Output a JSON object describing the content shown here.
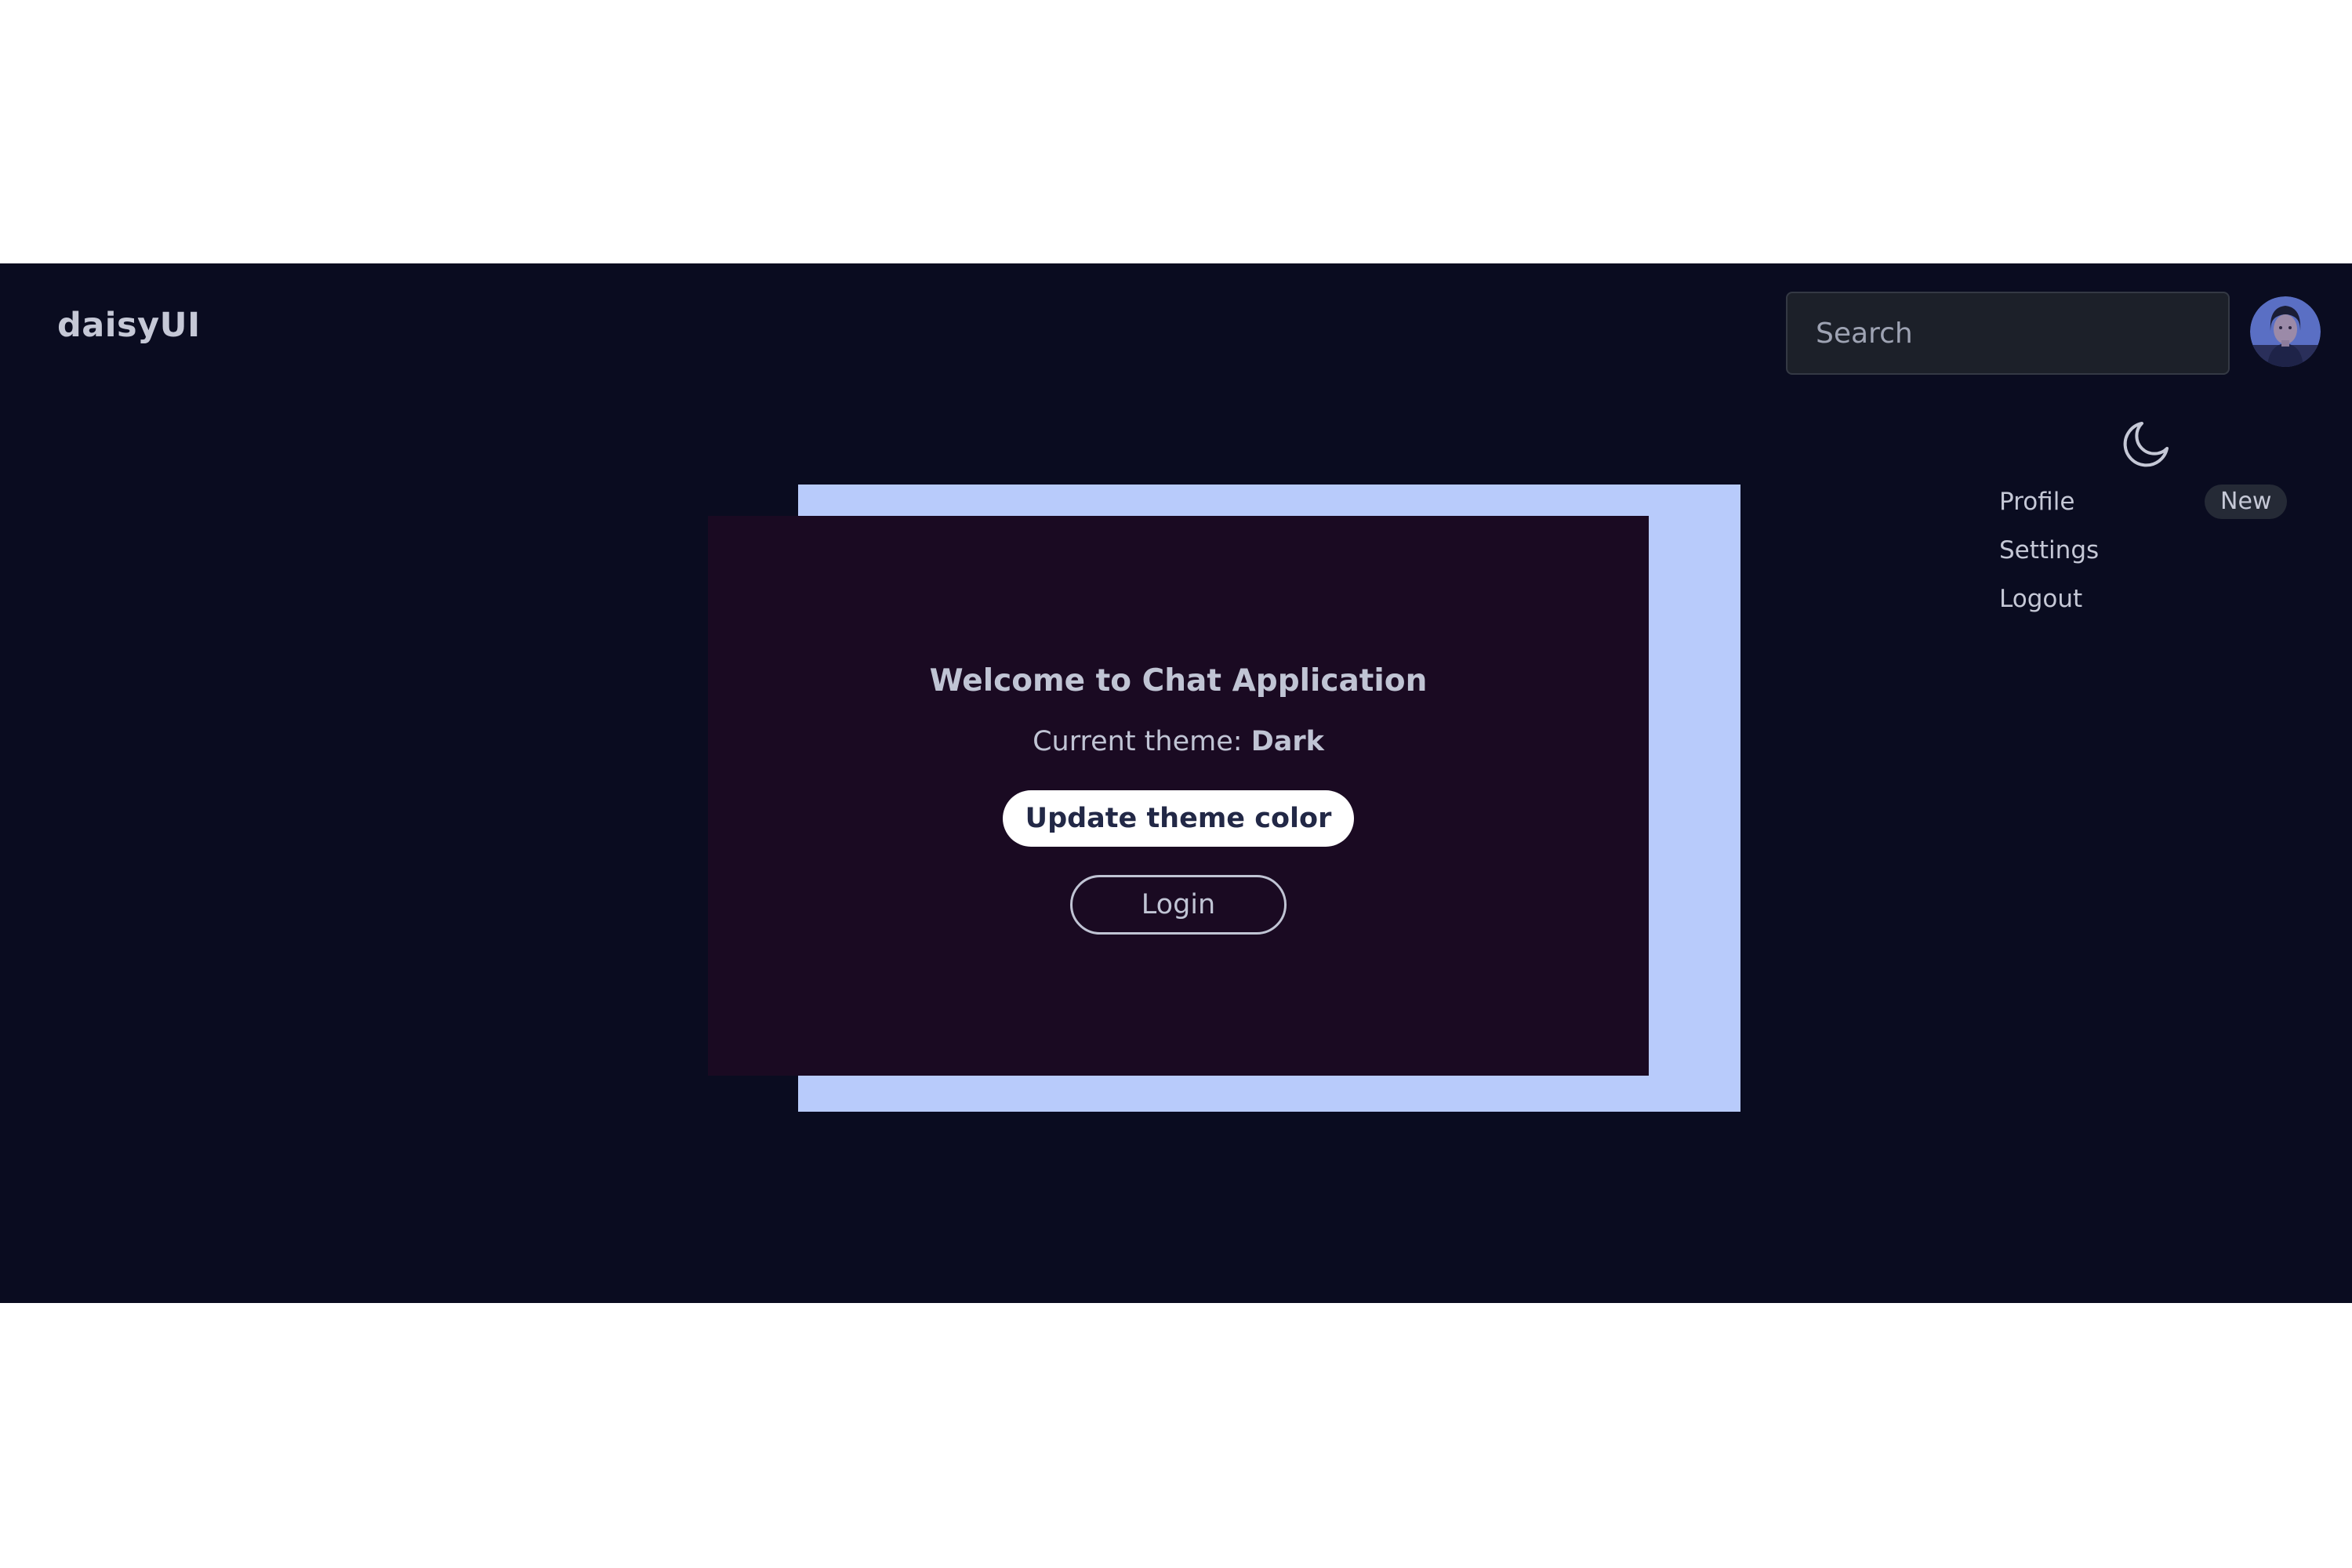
{
  "navbar": {
    "brand": "daisyUI",
    "search_placeholder": "Search",
    "avatar_icon": "user-avatar",
    "theme_icon": "moon-icon"
  },
  "menu": {
    "items": [
      {
        "label": "Profile",
        "badge": "New"
      },
      {
        "label": "Settings"
      },
      {
        "label": "Logout"
      }
    ]
  },
  "card": {
    "title": "Welcome to Chat Application",
    "theme_prefix": "Current theme:",
    "theme_name": "Dark",
    "update_button": "Update theme color",
    "login_button": "Login"
  },
  "colors": {
    "page_bg": "#0a0c20",
    "card_bg": "#1a0a22",
    "card_shadow": "#b8cbfb",
    "text": "#c5c8d6"
  }
}
